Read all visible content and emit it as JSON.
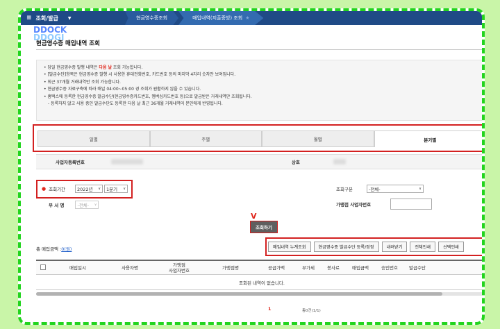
{
  "header": {
    "menu_title": "조회/발급",
    "dropdown_icon": "caret-down-icon",
    "breadcrumbs": [
      "현금영수증조회",
      "매입내역(지출증빙) 조회"
    ]
  },
  "watermark": [
    "DDOCK",
    "DDOGI"
  ],
  "page_title": "현금영수증 매입내역 조회",
  "notices": [
    {
      "before": "당일 현금영수증 발행 내역은 ",
      "highlight": "다음 날",
      "after": " 조회 가능합니다."
    },
    {
      "before": "[발급수단]항목은 현금영수증 발행 시 사용한 휴대전화번호, 카드번호 등의 마지막 4자리 숫자만 보여집니다.",
      "highlight": "",
      "after": ""
    },
    {
      "before": "최근 37개월 거래내역만 조회 가능합니다.",
      "highlight": "",
      "after": ""
    },
    {
      "before": "현금영수증 자료구축에 따라 매일 04:00~05:00 경 조회가 원활하지 않을 수 있습니다.",
      "highlight": "",
      "after": ""
    },
    {
      "before": "홈택스에 등록한 현금영수증 발급수단(현금영수증카드번호, 멤버십카드번호 등)으로 발급받은 거래내역만 조회됩니다.",
      "highlight": "",
      "after": ""
    },
    {
      "before": "- 등록하지 않고 사용 중인 발급수단도 등록한 다음 날 최근 36개월 거래내역이 본인에게 반영됩니다.",
      "highlight": "",
      "after": ""
    }
  ],
  "tabs": [
    {
      "label": "일별",
      "active": false
    },
    {
      "label": "주별",
      "active": false
    },
    {
      "label": "월별",
      "active": false
    },
    {
      "label": "분기별",
      "active": true
    }
  ],
  "form": {
    "biz_no_label": "사업자등록번호",
    "company_label": "상호",
    "period_label": "조회기간",
    "year_value": "2022년",
    "quarter_value": "1분기",
    "type_label": "조회구분",
    "type_value": "-전체-",
    "dept_label": "부 서 명",
    "dept_value": "-전체-",
    "merchant_label": "가맹점 사업자번호",
    "search_button": "조회하기"
  },
  "annotation_mark": "V",
  "summary": {
    "label": "총 매입금액 :",
    "count": "0(원)"
  },
  "action_buttons": [
    "매입내역 누계조회",
    "현금영수증 발급수단 등록/정정",
    "내려받기",
    "전체인쇄",
    "선택인쇄"
  ],
  "table": {
    "columns": [
      "매입일시",
      "사용자명",
      "가맹점\n사업자번호",
      "가맹점명",
      "공급가액",
      "부가세",
      "봉사료",
      "매입금액",
      "승인번호",
      "발급수단"
    ],
    "empty_message": "조회된 내역이 없습니다."
  },
  "pagination": {
    "current_page": "1",
    "total_text": "총0건(1/1)"
  },
  "colors": {
    "header_bg": "#1f4a86",
    "highlight_red": "#e0281d",
    "frame_green": "#22d41e",
    "link_blue": "#1c5cc9"
  }
}
